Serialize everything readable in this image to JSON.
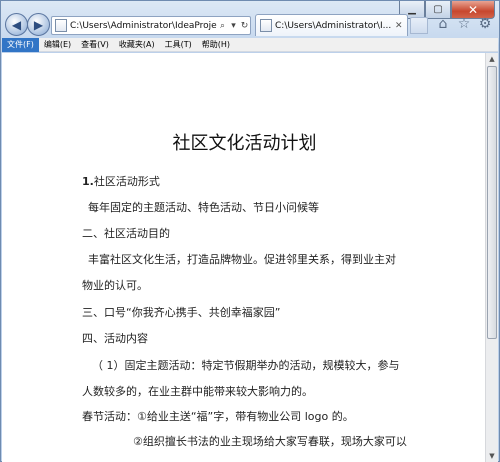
{
  "browser": {
    "address": "C:\\Users\\Administrator\\IdeaProjects\\Im",
    "tab_title": "C:\\Users\\Administrator\\I...",
    "menu": [
      "文件(F)",
      "编辑(E)",
      "查看(V)",
      "收藏夹(A)",
      "工具(T)",
      "帮助(H)"
    ],
    "window_controls": [
      "minimize",
      "maximize",
      "close"
    ]
  },
  "document": {
    "title": "社区文化活动计划",
    "section1_num": "1.",
    "section1_text": "社区活动形式",
    "section1_body": "每年固定的主题活动、特色活动、节日小问候等",
    "section2": "二、社区活动目的",
    "section2_body_line1": "丰富社区文化生活，打造品牌物业。促进邻里关系，得到业主对",
    "section2_body_line2": "物业的认可。",
    "section3": "三、口号“你我齐心携手、共创幸福家园”",
    "section4": "四、活动内容",
    "item1_line1": "（ 1）固定主题活动：特定节假期举办的活动，规模较大，参与",
    "item1_line2": "人数较多的，在业主群中能带来较大影响力的。",
    "spring_line": "春节活动：①给业主送“福”字，带有物业公司 logo 的。",
    "spring_line2": "②组织擅长书法的业主现场给大家写春联，现场大家可以"
  }
}
